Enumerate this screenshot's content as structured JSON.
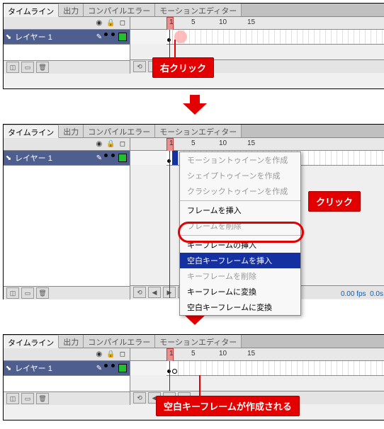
{
  "tabs": {
    "timeline": "タイムライン",
    "output": "出力",
    "compiler": "コンパイルエラー",
    "motion": "モーションエディター"
  },
  "layer": {
    "name": "レイヤー 1"
  },
  "ruler": {
    "n1": "1",
    "n5": "5",
    "n10": "10",
    "n15": "15"
  },
  "callouts": {
    "right_click": "右クリック",
    "click": "クリック",
    "blank_kf": "空白キーフレームが作成される"
  },
  "context_menu": {
    "motion_tween": "モーショントゥイーンを作成",
    "shape_tween": "シェイプトゥイーンを作成",
    "classic_tween": "クラシックトゥイーンを作成",
    "insert_frame": "フレームを挿入",
    "delete_frame": "フレームを削除",
    "insert_kf": "キーフレームの挿入",
    "insert_blank_kf": "空白キーフレームを挿入",
    "delete_kf": "キーフレームを削除",
    "convert_kf": "キーフレームに変換",
    "convert_blank_kf": "空白キーフレームに変換"
  },
  "status": {
    "fps": "0.00 fps",
    "sec": "0.0s"
  }
}
